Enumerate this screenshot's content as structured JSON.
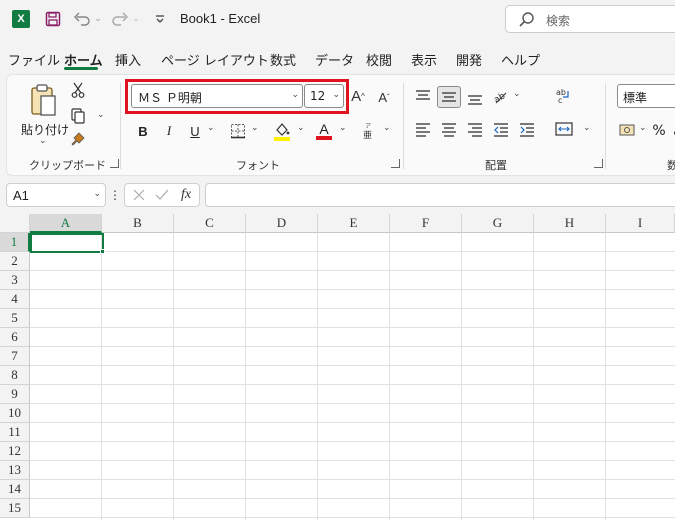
{
  "app": {
    "logo_letter": "X",
    "doc_title": "Book1  -  Excel"
  },
  "search": {
    "placeholder": "検索"
  },
  "tabs": [
    "ファイル",
    "ホーム",
    "挿入",
    "ページ レイアウト",
    "数式",
    "データ",
    "校閲",
    "表示",
    "開発",
    "ヘルプ"
  ],
  "active_tab": "ホーム",
  "ribbon": {
    "clipboard": {
      "paste_label": "貼り付け",
      "group_label": "クリップボード"
    },
    "font": {
      "font_name": "ＭＳ Ｐ明朝",
      "font_size": "12",
      "bold": "B",
      "italic": "I",
      "underline": "U",
      "font_color_letter": "A",
      "grow_font": "A",
      "shrink_font": "A",
      "group_label": "フォント",
      "highlight_color": "#e0141e"
    },
    "alignment": {
      "group_label": "配置"
    },
    "number": {
      "format": "標準",
      "percent": "%",
      "group_label_partial": "数"
    }
  },
  "formula_bar": {
    "name_box": "A1",
    "fx": "fx",
    "formula": ""
  },
  "sheet": {
    "columns": [
      "A",
      "B",
      "C",
      "D",
      "E",
      "F",
      "G",
      "H",
      "I"
    ],
    "rows": [
      "1",
      "2",
      "3",
      "4",
      "5",
      "6",
      "7",
      "8",
      "9",
      "10",
      "11",
      "12",
      "13",
      "14",
      "15"
    ],
    "selected_cell": "A1",
    "accent": "#107c41"
  }
}
